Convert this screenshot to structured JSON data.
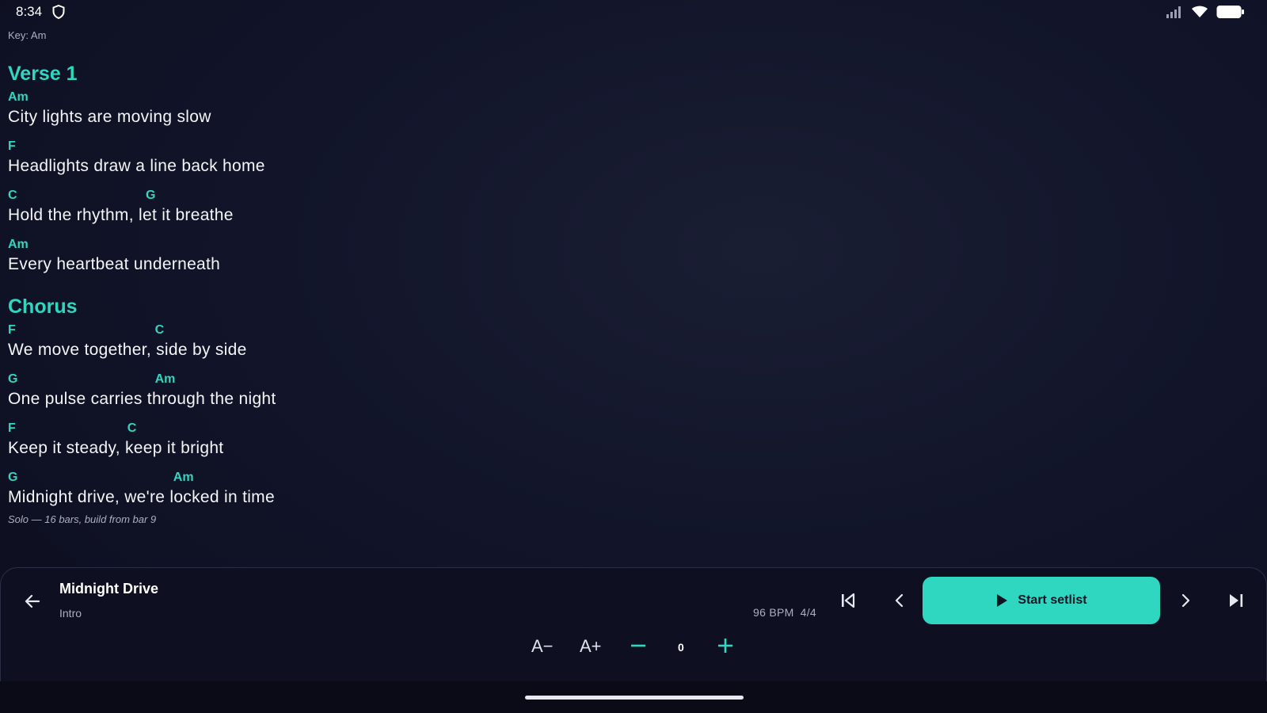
{
  "status": {
    "time": "8:34",
    "icons": [
      "shield-icon",
      "signal-icon",
      "wifi-icon",
      "battery-icon"
    ]
  },
  "key_label": "Key: Am",
  "sections": [
    {
      "title": "Verse 1",
      "lines": [
        {
          "chords": [
            {
              "name": "Am",
              "col": 0
            }
          ],
          "lyric": "City lights are moving slow"
        },
        {
          "chords": [
            {
              "name": "F",
              "col": 0
            }
          ],
          "lyric": "Headlights draw a line back home"
        },
        {
          "chords": [
            {
              "name": "C",
              "col": 0
            },
            {
              "name": "G",
              "col": 15
            }
          ],
          "lyric": "Hold the rhythm, let it breathe"
        },
        {
          "chords": [
            {
              "name": "Am",
              "col": 0
            }
          ],
          "lyric": "Every heartbeat underneath"
        }
      ]
    },
    {
      "title": "Chorus",
      "lines": [
        {
          "chords": [
            {
              "name": "F",
              "col": 0
            },
            {
              "name": "C",
              "col": 16
            }
          ],
          "lyric": "We move together, side by side"
        },
        {
          "chords": [
            {
              "name": "G",
              "col": 0
            },
            {
              "name": "Am",
              "col": 16
            }
          ],
          "lyric": "One pulse carries through the night"
        },
        {
          "chords": [
            {
              "name": "F",
              "col": 0
            },
            {
              "name": "C",
              "col": 13
            }
          ],
          "lyric": "Keep it steady, keep it bright"
        },
        {
          "chords": [
            {
              "name": "G",
              "col": 0
            },
            {
              "name": "Am",
              "col": 18
            }
          ],
          "lyric": "Midnight drive, we're locked in time"
        }
      ]
    }
  ],
  "note": "Solo — 16 bars, build from bar 9",
  "player": {
    "song_title": "Midnight Drive",
    "current_section": "Intro",
    "bpm": "96 BPM",
    "time_signature": "4/4",
    "start_label": "Start setlist",
    "font_smaller": "A−",
    "font_larger": "A+",
    "transpose_value": "0"
  },
  "colors": {
    "accent": "#2fd6c0",
    "background": "#12152a",
    "panel": "#0e1021"
  }
}
